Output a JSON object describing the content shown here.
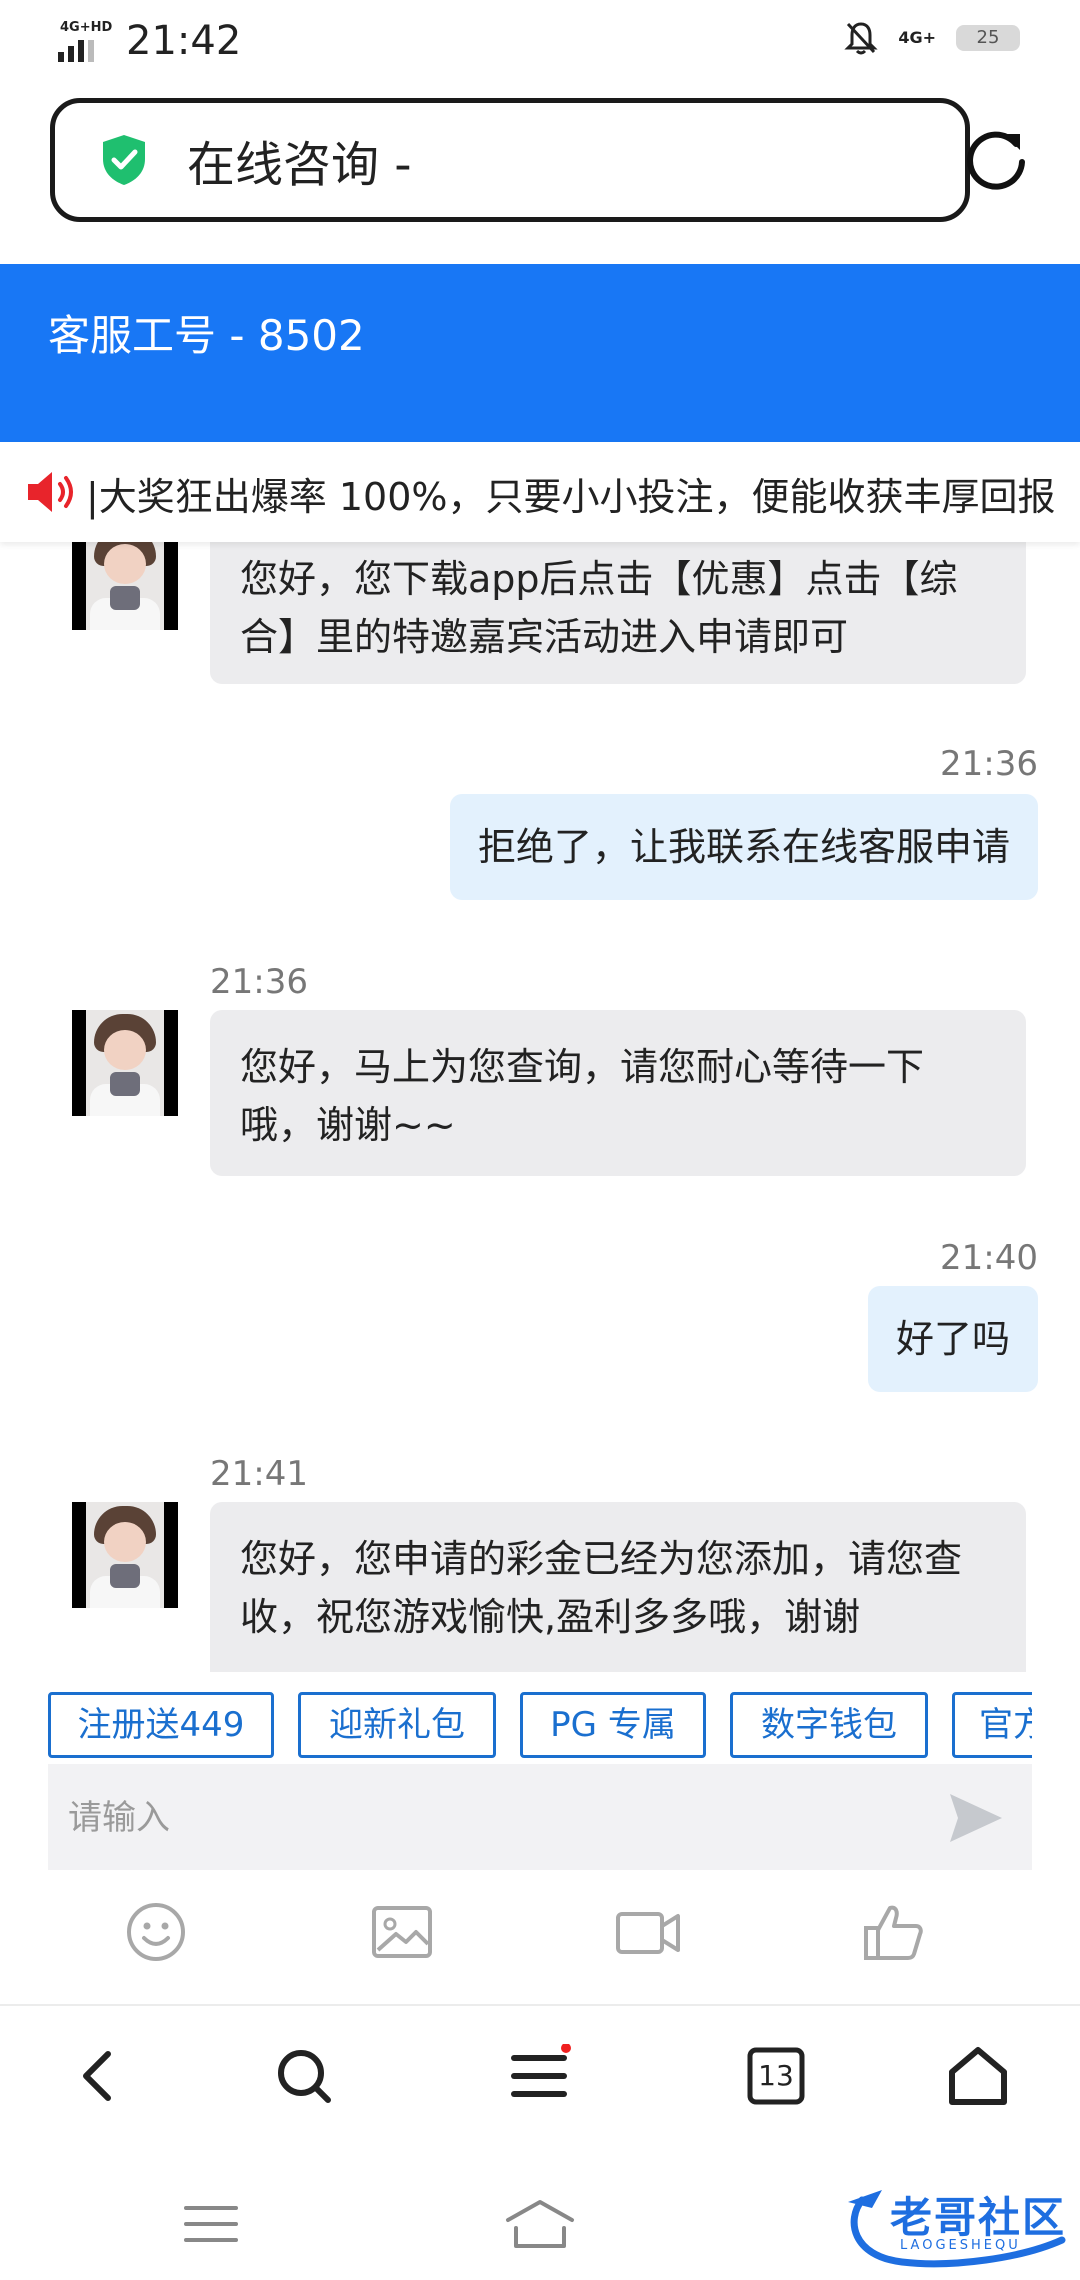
{
  "status_bar": {
    "network": "4G+HD",
    "time": "21:42",
    "network_right": "4G+",
    "battery": "25"
  },
  "browser": {
    "url_title": "在线咨询 -",
    "icons": [
      "shield-check-icon",
      "reload-icon"
    ]
  },
  "header": {
    "agent_id": "客服工号 - 8502",
    "color": "#1877f5"
  },
  "marquee": {
    "text": "|大奖狂出爆率 100%，只要小小投注，便能收获丰厚回报"
  },
  "messages": [
    {
      "from": "agent",
      "time": "",
      "text": "您好，您下载app后点击【优惠】点击【综合】里的特邀嘉宾活动进入申请即可"
    },
    {
      "from": "user",
      "time": "21:36",
      "text": "拒绝了，让我联系在线客服申请"
    },
    {
      "from": "agent",
      "time": "21:36",
      "text": "您好，马上为您查询，请您耐心等待一下哦，谢谢~~"
    },
    {
      "from": "user",
      "time": "21:40",
      "text": "好了吗"
    },
    {
      "from": "agent",
      "time": "21:41",
      "text": "您好，您申请的彩金已经为您添加，请您查收，祝您游戏愉快,盈利多多哦，谢谢"
    }
  ],
  "quick_replies": [
    "注册送449",
    "迎新礼包",
    "PG 专属",
    "数字钱包",
    "官方"
  ],
  "input": {
    "placeholder": "请输入",
    "value": ""
  },
  "toolbar_icons": [
    "emoji-icon",
    "image-icon",
    "video-icon",
    "thumbs-up-icon"
  ],
  "browser_nav": {
    "tab_count": "13",
    "icons": [
      "back-icon",
      "search-icon",
      "menu-icon",
      "tabs-icon",
      "home-icon"
    ]
  },
  "watermark": {
    "text": "老哥社区",
    "sub": "LAOGESHEQU"
  }
}
